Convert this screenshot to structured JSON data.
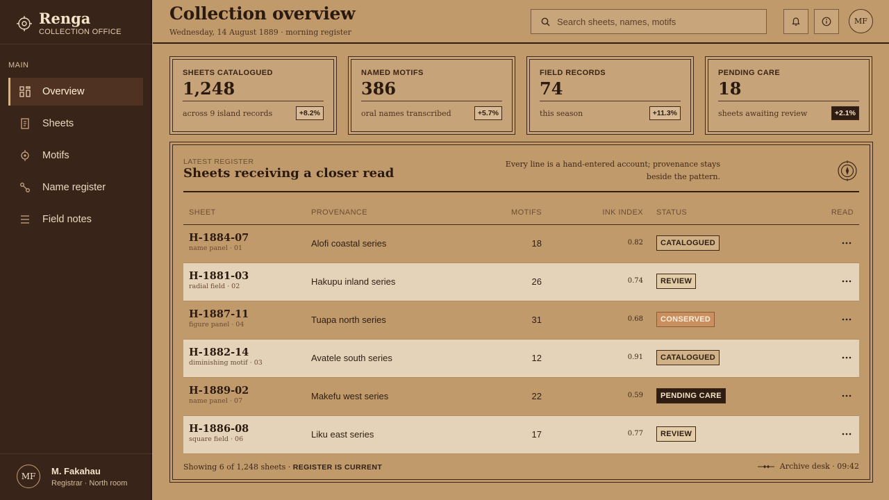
{
  "sidebar": {
    "brand": {
      "name": "Renga",
      "subtitle": "COLLECTION OFFICE"
    },
    "section_label": "MAIN",
    "items": [
      {
        "label": "Overview",
        "icon": "grid-icon",
        "active": true
      },
      {
        "label": "Sheets",
        "icon": "sheet-icon",
        "active": false
      },
      {
        "label": "Motifs",
        "icon": "motif-icon",
        "active": false
      },
      {
        "label": "Name register",
        "icon": "name-register-icon",
        "active": false
      },
      {
        "label": "Field notes",
        "icon": "field-notes-icon",
        "active": false
      }
    ],
    "user": {
      "initials": "MF",
      "name": "M. Fakahau",
      "role": "Registrar · North room"
    }
  },
  "header": {
    "title": "Collection overview",
    "date": "Wednesday, 14 August 1889 · morning register",
    "search_placeholder": "Search sheets, names, motifs",
    "avatar_initials": "MF"
  },
  "stats": [
    {
      "label": "SHEETS CATALOGUED",
      "value": "1,248",
      "note": "across 9 island records",
      "delta": "+8.2%",
      "dark": false
    },
    {
      "label": "NAMED MOTIFS",
      "value": "386",
      "note": "oral names transcribed",
      "delta": "+5.7%",
      "dark": false
    },
    {
      "label": "FIELD RECORDS",
      "value": "74",
      "note": "this season",
      "delta": "+11.3%",
      "dark": false
    },
    {
      "label": "PENDING CARE",
      "value": "18",
      "note": "sheets awaiting review",
      "delta": "+2.1%",
      "dark": true
    }
  ],
  "register": {
    "eyebrow": "LATEST REGISTER",
    "title": "Sheets receiving a closer read",
    "description": "Every line is a hand-entered account; provenance stays beside the pattern.",
    "columns": {
      "sheet": "SHEET",
      "provenance": "PROVENANCE",
      "motifs": "MOTIFS",
      "ink": "INK INDEX",
      "status": "STATUS",
      "read": "READ"
    },
    "rows": [
      {
        "id": "H-1884-07",
        "sub": "name panel · 01",
        "provenance": "Alofi coastal series",
        "motifs": "18",
        "ink": "0.82",
        "status": "CATALOGUED",
        "status_kind": "catalogued"
      },
      {
        "id": "H-1881-03",
        "sub": "radial field · 02",
        "provenance": "Hakupu inland series",
        "motifs": "26",
        "ink": "0.74",
        "status": "REVIEW",
        "status_kind": "review"
      },
      {
        "id": "H-1887-11",
        "sub": "figure panel · 04",
        "provenance": "Tuapa north series",
        "motifs": "31",
        "ink": "0.68",
        "status": "CONSERVED",
        "status_kind": "conserved"
      },
      {
        "id": "H-1882-14",
        "sub": "diminishing motif · 03",
        "provenance": "Avatele south series",
        "motifs": "12",
        "ink": "0.91",
        "status": "CATALOGUED",
        "status_kind": "catalogued"
      },
      {
        "id": "H-1889-02",
        "sub": "name panel · 07",
        "provenance": "Makefu west series",
        "motifs": "22",
        "ink": "0.59",
        "status": "PENDING CARE",
        "status_kind": "pending"
      },
      {
        "id": "H-1886-08",
        "sub": "square field · 06",
        "provenance": "Liku east series",
        "motifs": "17",
        "ink": "0.77",
        "status": "REVIEW",
        "status_kind": "review"
      }
    ],
    "footer_count": "Showing 6 of 1,248 sheets ·",
    "footer_state": "REGISTER IS CURRENT",
    "footer_right": "Archive desk · 09:42"
  },
  "colors": {
    "background": "#c19a6b",
    "sidebar": "#39241a",
    "ink": "#2e1d12",
    "pending": "#2f1c12",
    "conserved": "#c98f5f"
  }
}
